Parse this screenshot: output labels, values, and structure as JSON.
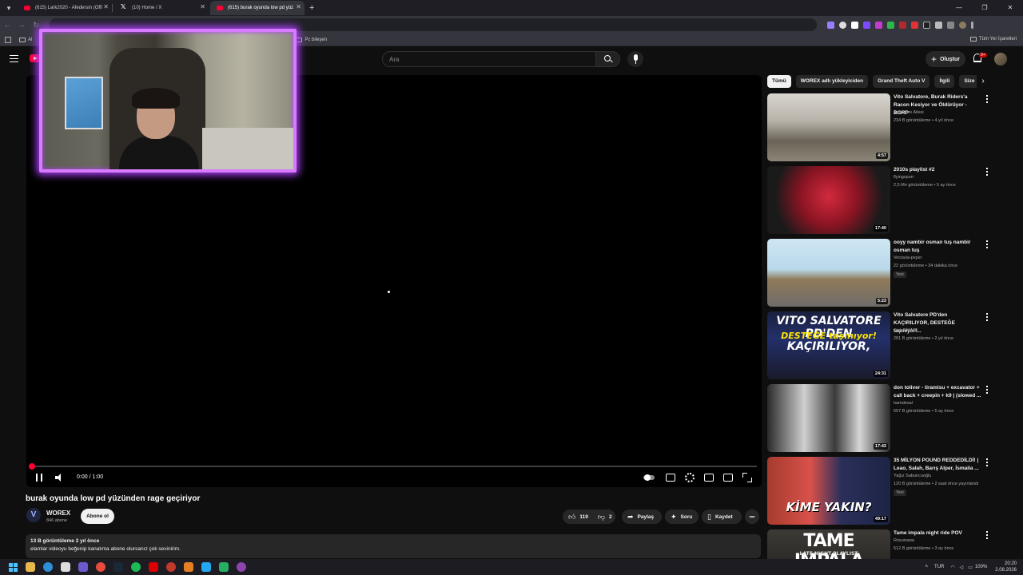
{
  "browser": {
    "tabs": [
      {
        "title": "(615) Lark2020 - Afedersin (Offi",
        "icon": "youtube-icon",
        "active": false
      },
      {
        "title": "(10) Home / X",
        "icon": "x-icon",
        "active": false
      },
      {
        "title": "(615) burak oyunda low pd yüz",
        "icon": "youtube-icon",
        "active": true
      }
    ],
    "bookmarks": [
      "Al",
      "Pc bileşen"
    ],
    "all_bookmarks_label": "Tüm Yer İşaretleri"
  },
  "masthead": {
    "search_placeholder": "Ara",
    "create_label": "Oluştur",
    "notifications_badge": "9+"
  },
  "player": {
    "time": "0:00 / 1:00",
    "progress": 0
  },
  "video": {
    "title": "burak oyunda low pd yüzünden rage geçiriyor",
    "channel": "WOREX",
    "channel_initial": "V",
    "subscribers": "846 abone",
    "subscribe_label": "Abone ol",
    "likes": "119",
    "dislikes": "2",
    "share_label": "Paylaş",
    "ask_label": "Soru",
    "save_label": "Kaydet",
    "description_meta": "13 B görüntüleme  2 yıl önce",
    "description_text": "elamlar videoyu beğenip kanalıma abone olursanız çok sevinirim."
  },
  "chips": [
    "Tümü",
    "WOREX adlı yükleyiciden",
    "Grand Theft Auto V",
    "İlgili",
    "Size"
  ],
  "recommendations": [
    {
      "title": "Vito Salvatore, Burak Riders'a Racon Kesiyor ve Öldürüyor - BORP",
      "channel": "Salvatore Ailesi",
      "meta": "234 B görüntüleme • 4 yıl önce",
      "duration": "4:57",
      "badge": ""
    },
    {
      "title": "2010s playlist #2",
      "channel": "flyingspurr",
      "meta": "2,5 Mn görüntüleme • 5 ay önce",
      "duration": "17:40",
      "badge": ""
    },
    {
      "title": "ooyy nambir osman tuş nambir osman tuş",
      "channel": "Vectaria-pvper",
      "meta": "22 görüntüleme • 34 dakika önce",
      "duration": "5:23",
      "badge": "Yeni"
    },
    {
      "title": "Vito Salvatore PD'den KAÇIRILIYOR, DESTEĞE taşınıyor!...",
      "channel": "Kick DİYARI",
      "meta": "281 B görüntüleme • 2 yıl önce",
      "duration": "24:31",
      "badge": "",
      "thumb_line1": "VITO SALVATORE PD'DEN KAÇIRILIYOR,",
      "thumb_line2": "DESTEĞE taşınıyor!"
    },
    {
      "title": "don toliver - tiramisu + excavator + call back + creepin + k9 | (slowed ...",
      "channel": "hamdesal",
      "meta": "657 B görüntüleme • 5 ay önce",
      "duration": "17:43",
      "badge": ""
    },
    {
      "title": "35 MİLYON POUND REDDEDİLDİ! | Leao, Salah, Barış Alper, İsmaila ...",
      "channel": "Yağız Sabuncuoğlu",
      "meta": "120 B görüntüleme • 2 saat önce yayınlandı",
      "duration": "49:17",
      "badge": "Yeni",
      "thumb_line1": "KİME YAKIN?"
    },
    {
      "title": "Tame impala night ride POV",
      "channel": "Rosunawa",
      "meta": "512 B görüntüleme • 3 ay önce",
      "duration": "",
      "badge": "",
      "thumb_line1": "TAME IMPALA",
      "thumb_line2": "LATE NIGHT PLAYLIST"
    }
  ],
  "taskbar": {
    "language": "TUR",
    "battery": "100%",
    "time": "20:20",
    "date": "2.08.2026"
  },
  "colors": {
    "accent": "#ff0033",
    "background": "#0f0f0f",
    "cam_border": "#d97bff"
  }
}
